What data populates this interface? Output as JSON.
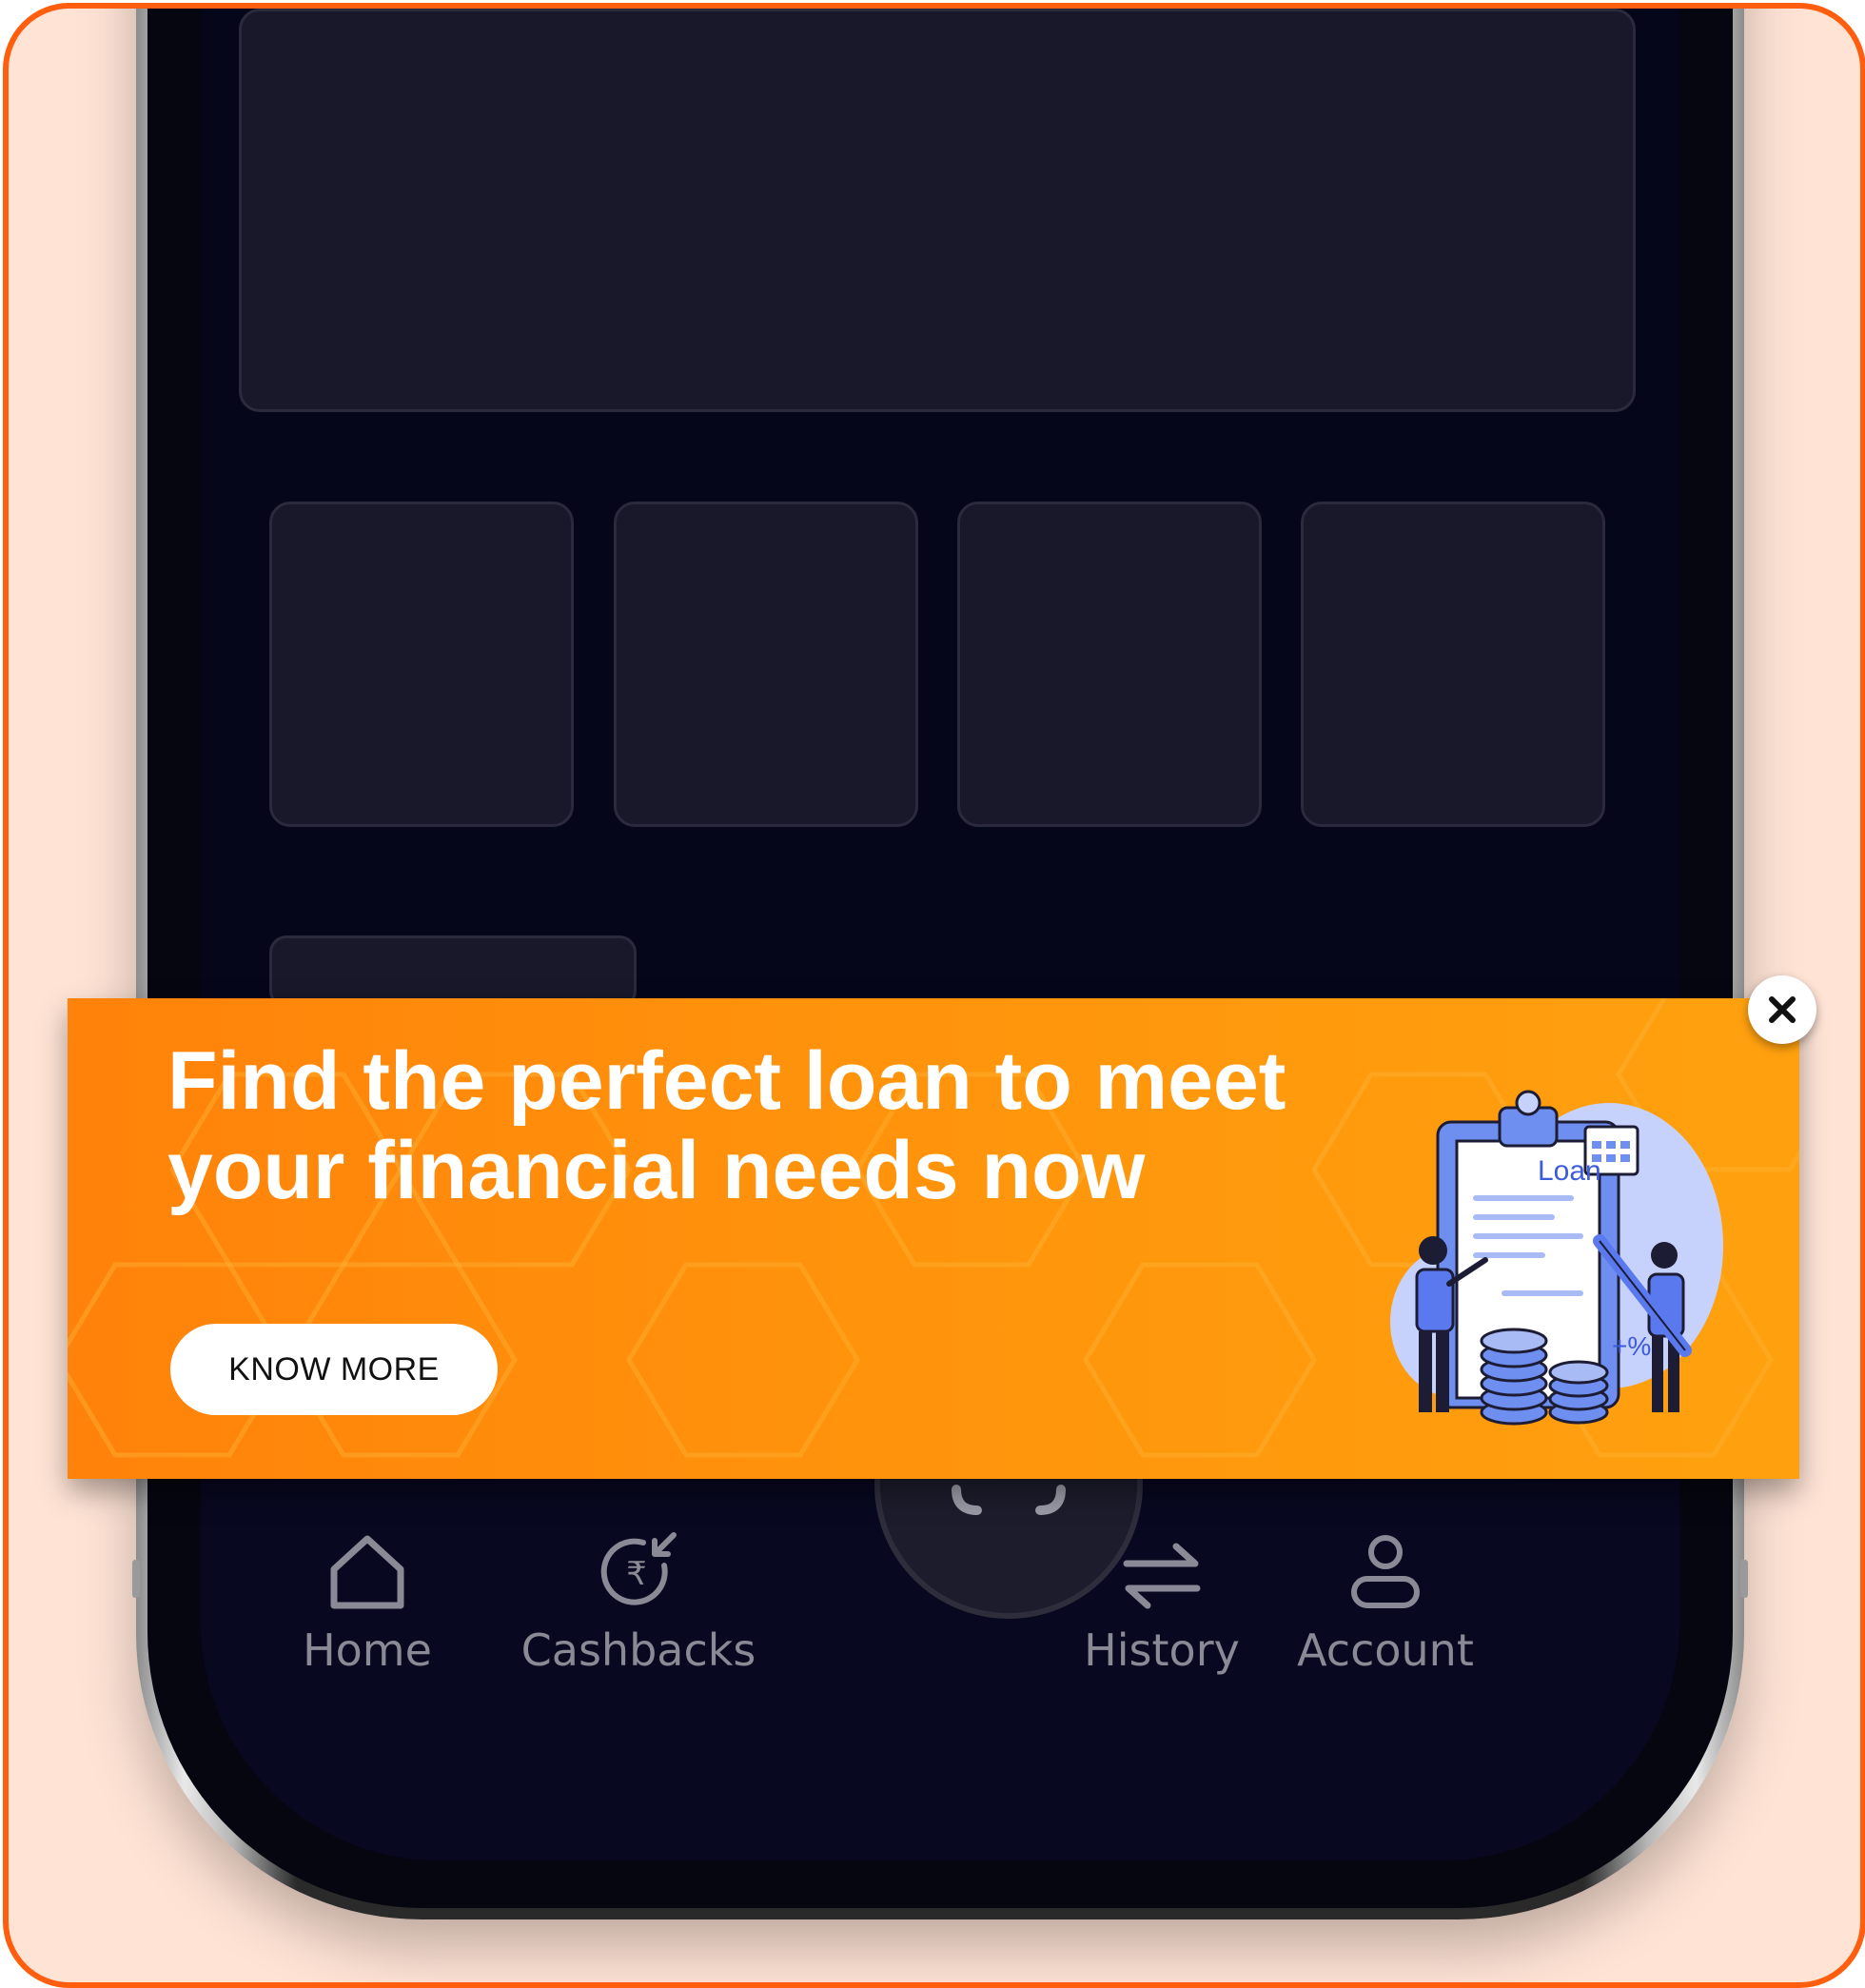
{
  "banner": {
    "headline_line1": "Find the perfect loan to meet",
    "headline_line2": "your financial needs now",
    "cta_label": "KNOW MORE",
    "illustration": {
      "label": "Loan",
      "rate_badge": "+%"
    },
    "close_icon": "close-icon",
    "accent_color": "#ff8a0b"
  },
  "nav": {
    "items": [
      {
        "label": "Home",
        "icon": "home-icon"
      },
      {
        "label": "Cashbacks",
        "icon": "cashback-rupee-icon"
      },
      {
        "label": "History",
        "icon": "transfer-arrows-icon"
      },
      {
        "label": "Account",
        "icon": "user-icon"
      }
    ],
    "center_button_icon": "scan-icon"
  },
  "colors": {
    "frame_border": "#ff5e0e",
    "frame_background": "#ffe4d6",
    "screen_background": "#06061a",
    "nav_text": "#8a8a96"
  }
}
